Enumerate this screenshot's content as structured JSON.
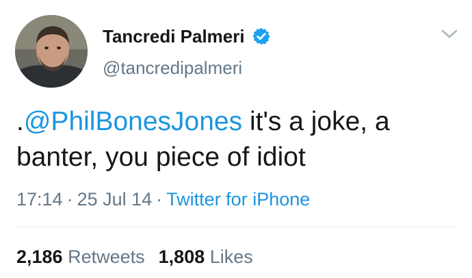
{
  "author": {
    "display_name": "Tancredi Palmeri",
    "handle": "@tancredipalmeri",
    "avatar_icon": "avatar-photo",
    "verified_icon": "verified-badge-icon"
  },
  "tweet": {
    "prefix": ".",
    "mention": "@PhilBonesJones",
    "text": " it's a joke, a banter, you piece of idiot"
  },
  "meta": {
    "time": "17:14",
    "separator": "·",
    "date": "25 Jul 14",
    "source": "Twitter for iPhone"
  },
  "stats": {
    "retweets_count": "2,186",
    "retweets_label": "Retweets",
    "likes_count": "1,808",
    "likes_label": "Likes"
  },
  "colors": {
    "link": "#1b95e0",
    "secondary_text": "#657786",
    "primary_text": "#14171a",
    "verified": "#1da1f2"
  }
}
